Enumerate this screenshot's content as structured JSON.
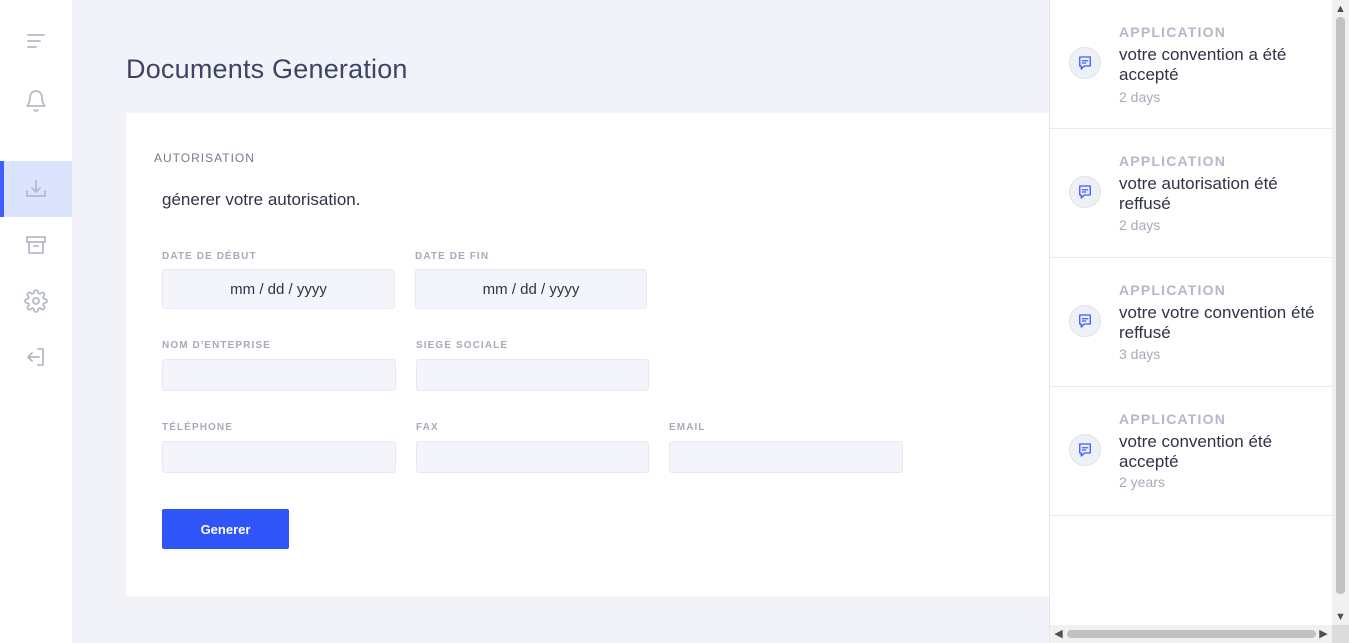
{
  "page": {
    "title": "Documents Generation"
  },
  "sidebar": {
    "items": [
      {
        "icon": "menu-lines-icon"
      },
      {
        "icon": "bell-icon"
      },
      {
        "icon": "download-tray-icon",
        "active": true
      },
      {
        "icon": "archive-box-icon"
      },
      {
        "icon": "gear-icon"
      },
      {
        "icon": "logout-icon"
      }
    ]
  },
  "form": {
    "title": "AUTORISATION",
    "description": "génerer votre autorisation.",
    "fields": {
      "date_debut": {
        "label": "DATE DE DÉBUT",
        "value": "mm / dd / yyyy"
      },
      "date_fin": {
        "label": "DATE DE FIN",
        "value": "mm / dd / yyyy"
      },
      "nom_entreprise": {
        "label": "NOM D'ENTEPRISE",
        "value": ""
      },
      "siege_sociale": {
        "label": "SIEGE SOCIALE",
        "value": ""
      },
      "telephone": {
        "label": "TÉLÉPHONE",
        "value": ""
      },
      "fax": {
        "label": "FAX",
        "value": ""
      },
      "email": {
        "label": "EMAIL",
        "value": ""
      }
    },
    "submit_label": "Generer"
  },
  "notifications": [
    {
      "category": "APPLICATION",
      "message": "votre convention a été accepté",
      "time": "2 days",
      "icon": "message-icon"
    },
    {
      "category": "APPLICATION",
      "message": "votre autorisation été reffusé",
      "time": "2 days",
      "icon": "message-icon"
    },
    {
      "category": "APPLICATION",
      "message": "votre votre convention été reffusé",
      "time": "3 days",
      "icon": "message-icon"
    },
    {
      "category": "APPLICATION",
      "message": "votre convention été accepté",
      "time": "2 years",
      "icon": "message-icon"
    }
  ],
  "colors": {
    "accent": "#2f54f7",
    "sidebar_active_bg": "#dce3fd",
    "background": "#f2f3f8"
  }
}
